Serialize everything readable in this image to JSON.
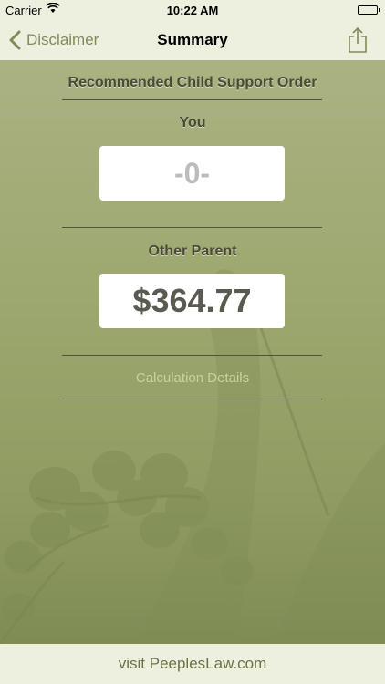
{
  "status": {
    "carrier": "Carrier",
    "time": "10:22 AM"
  },
  "nav": {
    "back_label": "Disclaimer",
    "title": "Summary"
  },
  "summary": {
    "heading": "Recommended Child Support Order",
    "you_label": "You",
    "you_value": "-0-",
    "other_label": "Other Parent",
    "other_value": "$364.77",
    "details_link": "Calculation Details"
  },
  "footer": {
    "link_text": "visit PeeplesLaw.com"
  },
  "colors": {
    "accent": "#82895b",
    "background_green": "#9da870",
    "bar": "#eef0df"
  }
}
